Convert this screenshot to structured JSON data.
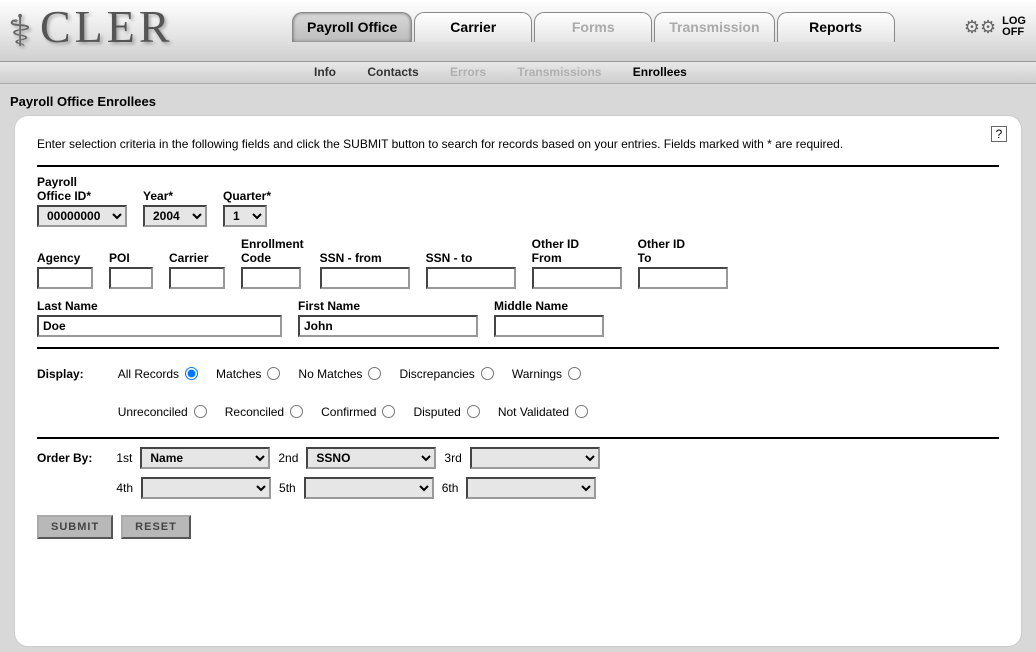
{
  "app": {
    "logo_text": "CLER"
  },
  "tabs": {
    "payroll": "Payroll Office",
    "carrier": "Carrier",
    "forms": "Forms",
    "transmission": "Transmission",
    "reports": "Reports"
  },
  "logoff": {
    "line1": "LOG",
    "line2": "OFF"
  },
  "subtabs": {
    "info": "Info",
    "contacts": "Contacts",
    "errors": "Errors",
    "transmissions": "Transmissions",
    "enrollees": "Enrollees"
  },
  "page_title": "Payroll Office Enrollees",
  "help_glyph": "?",
  "intro": "Enter selection criteria in the following fields and click the SUBMIT button to search for records based on your entries.  Fields marked with * are required.",
  "labels": {
    "payroll_office_id": "Payroll\nOffice ID*",
    "year": "Year*",
    "quarter": "Quarter*",
    "agency": "Agency",
    "poi": "POI",
    "carrier": "Carrier",
    "enrollment_code": "Enrollment\nCode",
    "ssn_from": "SSN - from",
    "ssn_to": "SSN - to",
    "other_id_from": "Other ID\nFrom",
    "other_id_to": "Other ID\nTo",
    "last_name": "Last Name",
    "first_name": "First Name",
    "middle_name": "Middle Name",
    "display": "Display:",
    "orderby": "Order By:"
  },
  "values": {
    "payroll_office_id": "00000000",
    "year": "2004",
    "quarter": "1",
    "agency": "",
    "poi": "",
    "carrier": "",
    "enrollment_code": "",
    "ssn_from": "",
    "ssn_to": "",
    "other_id_from": "",
    "other_id_to": "",
    "last_name": "Doe",
    "first_name": "John",
    "middle_name": ""
  },
  "display_options": {
    "all": "All Records",
    "matches": "Matches",
    "nomatches": "No Matches",
    "discrep": "Discrepancies",
    "warn": "Warnings",
    "unrec": "Unreconciled",
    "rec": "Reconciled",
    "conf": "Confirmed",
    "disp": "Disputed",
    "notval": "Not Validated"
  },
  "display_selected": "all",
  "order": {
    "lbl1": "1st",
    "lbl2": "2nd",
    "lbl3": "3rd",
    "lbl4": "4th",
    "lbl5": "5th",
    "lbl6": "6th",
    "v1": "Name",
    "v2": "SSNO",
    "v3": "",
    "v4": "",
    "v5": "",
    "v6": ""
  },
  "buttons": {
    "submit": "SUBMIT",
    "reset": "RESET"
  }
}
